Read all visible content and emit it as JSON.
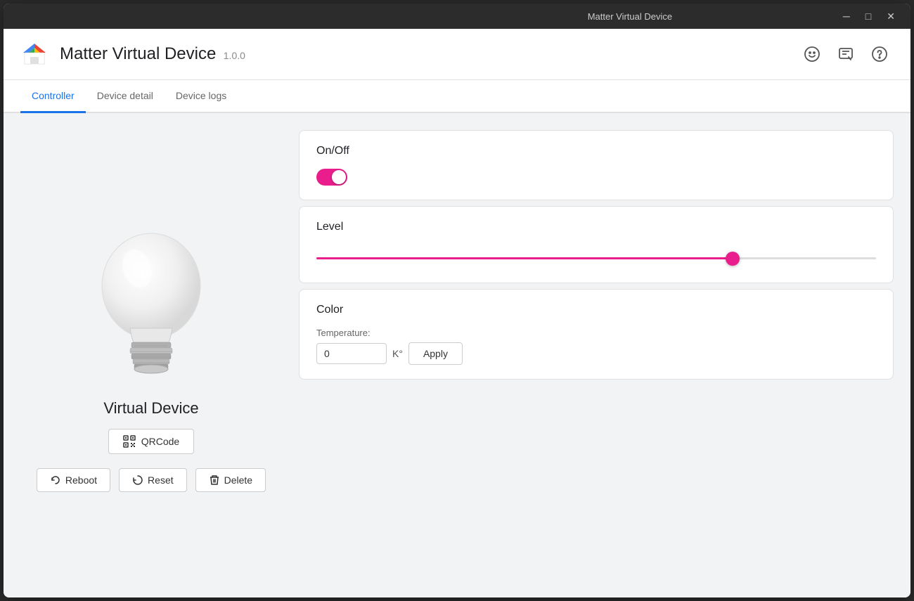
{
  "titleBar": {
    "title": "Matter Virtual Device",
    "minimize": "─",
    "maximize": "□",
    "close": "✕"
  },
  "header": {
    "appName": "Matter Virtual Device",
    "version": "1.0.0",
    "icons": {
      "emoji": "☺",
      "feedback": "⊡",
      "help": "?"
    }
  },
  "tabs": [
    {
      "id": "controller",
      "label": "Controller",
      "active": true
    },
    {
      "id": "device-detail",
      "label": "Device detail",
      "active": false
    },
    {
      "id": "device-logs",
      "label": "Device logs",
      "active": false
    }
  ],
  "leftPanel": {
    "deviceName": "Virtual Device",
    "qrcodeLabel": "QRCode",
    "rebootLabel": "Reboot",
    "resetLabel": "Reset",
    "deleteLabel": "Delete"
  },
  "cards": {
    "onOff": {
      "title": "On/Off",
      "toggleOn": true
    },
    "level": {
      "title": "Level",
      "value": 75
    },
    "color": {
      "title": "Color",
      "temperatureLabel": "Temperature:",
      "temperatureValue": "0",
      "temperatureUnit": "K°",
      "applyLabel": "Apply"
    }
  }
}
